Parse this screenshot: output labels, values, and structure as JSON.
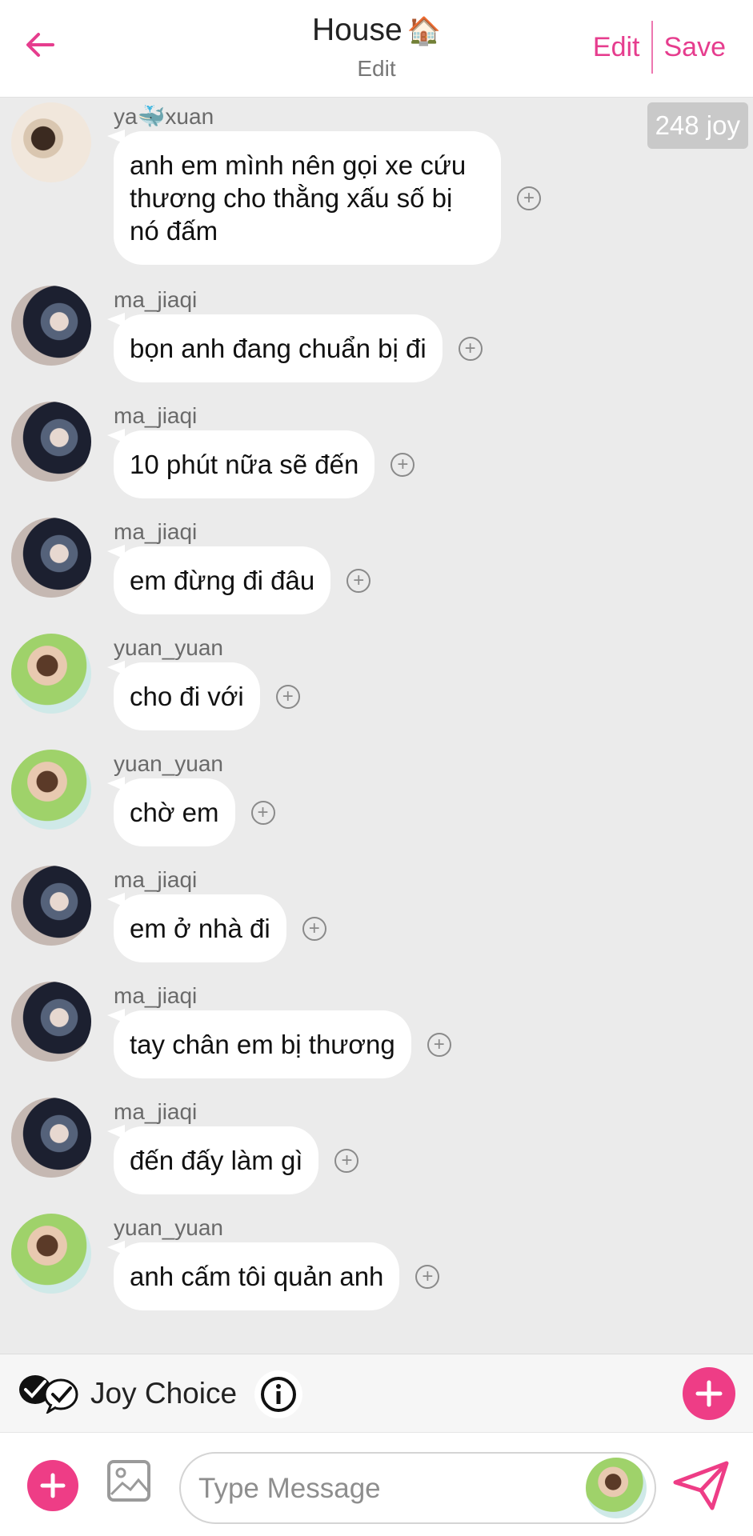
{
  "header": {
    "title": "House",
    "title_emoji": "🏠",
    "subtitle": "Edit",
    "edit_label": "Edit",
    "save_label": "Save",
    "accent_color": "#e63d8e"
  },
  "joy_balance": "248 joy",
  "messages": [
    {
      "user": "ya🐳xuan",
      "text": "anh em mình nên gọi xe cứu\nthương cho thằng xấu số bị\nnó đấm",
      "avatar": "yaxuan"
    },
    {
      "user": "ma_jiaqi",
      "text": "bọn anh đang chuẩn bị đi",
      "avatar": "ma"
    },
    {
      "user": "ma_jiaqi",
      "text": "10 phút nữa sẽ đến",
      "avatar": "ma"
    },
    {
      "user": "ma_jiaqi",
      "text": "em đừng đi đâu",
      "avatar": "ma"
    },
    {
      "user": "yuan_yuan",
      "text": "cho đi với",
      "avatar": "yuan"
    },
    {
      "user": "yuan_yuan",
      "text": "chờ em",
      "avatar": "yuan"
    },
    {
      "user": "ma_jiaqi",
      "text": "em ở nhà đi",
      "avatar": "ma"
    },
    {
      "user": "ma_jiaqi",
      "text": "tay chân em bị thương",
      "avatar": "ma"
    },
    {
      "user": "ma_jiaqi",
      "text": "đến đấy làm gì",
      "avatar": "ma"
    },
    {
      "user": "yuan_yuan",
      "text": "anh cấm tôi quản anh",
      "avatar": "yuan"
    }
  ],
  "joy_choice": {
    "label": "Joy Choice"
  },
  "compose": {
    "placeholder": "Type Message"
  },
  "icons": {
    "back": "arrow-left-icon",
    "add": "plus-circle-icon",
    "info": "info-icon",
    "image": "image-icon",
    "send": "send-icon",
    "joy": "chat-check-icon"
  }
}
